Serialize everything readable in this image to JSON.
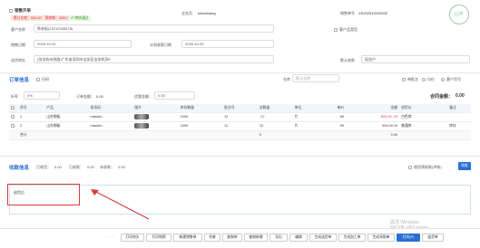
{
  "header": {
    "title": "销售开单",
    "badge_paid_label": "累计欠款：",
    "badge_paid_value": "500.00",
    "badge_balance_label": "预收款：",
    "badge_balance_value": "4300.00",
    "status_badge": "审核通过",
    "salesperson_label": "业务员",
    "salesperson_value": "miaoshang",
    "order_no_label": "销售单号",
    "order_no_value": "XS202510200002",
    "stamp_text": "已审"
  },
  "form": {
    "customer_label": "客户名称",
    "customer_value": "陈老板(13212345678)",
    "new_customer_label": "客户品类型",
    "sales_date_label": "销售日期",
    "sales_date_value": "2025-10-20",
    "plan_date_label": "计划收款日期",
    "plan_date_value": "2025-10-20",
    "address_label": "送货地址",
    "address_value": "(张龙杭州线路)广东省深圳市宝安区宝安机场T",
    "account_label": "默认收款",
    "account_value": "现金户"
  },
  "order": {
    "section_title": "订单信息",
    "search_label": "扫码",
    "warehouse_label": "仓库",
    "warehouse_placeholder": "默认仓库",
    "opt1": "带批次",
    "opt2": "均价",
    "opt3": "客户货号",
    "discount_label": "折率",
    "discount_value": "0%",
    "order_amount_label": "订单金额：",
    "order_amount_value": "0.00",
    "pay_amount_label": "优惠金额：",
    "pay_amount_value": "0.00",
    "total_label": "合同金额：",
    "total_value": "0.00"
  },
  "table": {
    "headers": [
      "序号",
      "产品",
      "条形码",
      "图片",
      "库存数量",
      "批次号",
      "总数量",
      "单位",
      "单价",
      "金额",
      "进货价",
      "备注"
    ],
    "amount_hdr": "金额",
    "cost_hdr": "进货价",
    "rows": [
      {
        "no": "1",
        "product": "山东钢板",
        "code": "miaosh...",
        "stock": "1000",
        "batch": "11",
        "qty": "-10",
        "unit": "片",
        "price": "50",
        "amount": "-500.00",
        "cost": "-10",
        "ware": "白色库",
        "note": ""
      },
      {
        "no": "2",
        "product": "山东钢板",
        "code": "miaosh...",
        "stock": "1000",
        "batch": "11",
        "qty": "10",
        "unit": "片",
        "price": "50",
        "amount": "500.00",
        "cost": "10",
        "ware": "普通库",
        "note": "库存"
      }
    ],
    "sum_label": "合计",
    "sum_qty": "0",
    "sum_amount": "0",
    "sum_total": "0.00"
  },
  "payment": {
    "section_title": "收款信息",
    "paid_label": "已收货：",
    "paid_value": "0.00",
    "received_label": "已收款：",
    "received_value": "0.00",
    "unpaid_label": "未收款：",
    "unpaid_value": "0.00",
    "use_prepay_label": "使用预收款(冲账)",
    "apply_button": "收款"
  },
  "remark": {
    "text": "退货后"
  },
  "watermark": {
    "line1": "激活 Windows",
    "line2": "转到\"设置\"以激活 Windows。"
  },
  "toolbar": {
    "buttons": [
      "打印快头",
      "打印和预",
      "新建销售单",
      "作废",
      "复制单",
      "复制新增",
      "导出",
      "编辑",
      "生成送货单",
      "生成加工单",
      "生成采购单",
      "打印(P)",
      "退货单"
    ]
  },
  "colors": {
    "accent": "#2b6fd6",
    "danger": "#e0312b",
    "annotation": "#d93b3b"
  }
}
